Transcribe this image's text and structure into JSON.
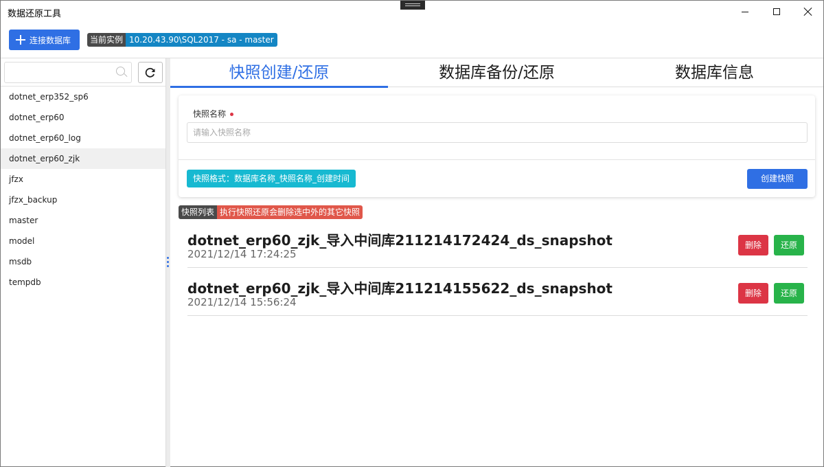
{
  "window": {
    "title": "数据还原工具",
    "controls": [
      "minimize-icon",
      "maximize-icon",
      "close-icon"
    ]
  },
  "toolbar": {
    "connect_label": "连接数据库",
    "instance_label": "当前实例",
    "instance_value": "10.20.43.90\\SQL2017 - sa - master"
  },
  "sidebar": {
    "search_placeholder": "",
    "search_value": "",
    "databases": [
      "dotnet_erp352_sp6",
      "dotnet_erp60",
      "dotnet_erp60_log",
      "dotnet_erp60_zjk",
      "jfzx",
      "jfzx_backup",
      "master",
      "model",
      "msdb",
      "tempdb"
    ],
    "selected": "dotnet_erp60_zjk"
  },
  "tabs": [
    {
      "label": "快照创建/还原",
      "active": true
    },
    {
      "label": "数据库备份/还原",
      "active": false
    },
    {
      "label": "数据库信息",
      "active": false
    }
  ],
  "form": {
    "field_label": "快照名称",
    "input_placeholder": "请输入快照名称",
    "input_value": "",
    "format_hint": "快照格式：数据库名称_快照名称_创建时间",
    "create_label": "创建快照"
  },
  "snapshot_list": {
    "label": "快照列表",
    "warning": "执行快照还原会删除选中外的其它快照",
    "items": [
      {
        "name": "dotnet_erp60_zjk_导入中间库211214172424_ds_snapshot",
        "time": "2021/12/14 17:24:25",
        "delete_label": "删除",
        "restore_label": "还原"
      },
      {
        "name": "dotnet_erp60_zjk_导入中间库211214155622_ds_snapshot",
        "time": "2021/12/14 15:56:24",
        "delete_label": "删除",
        "restore_label": "还原"
      }
    ]
  },
  "colors": {
    "primary": "#2f6fe4",
    "danger": "#dc3545",
    "success": "#28b34a",
    "info": "#17b9d1",
    "instance_badge": "#1486c4",
    "warning_badge": "#e0574a"
  }
}
